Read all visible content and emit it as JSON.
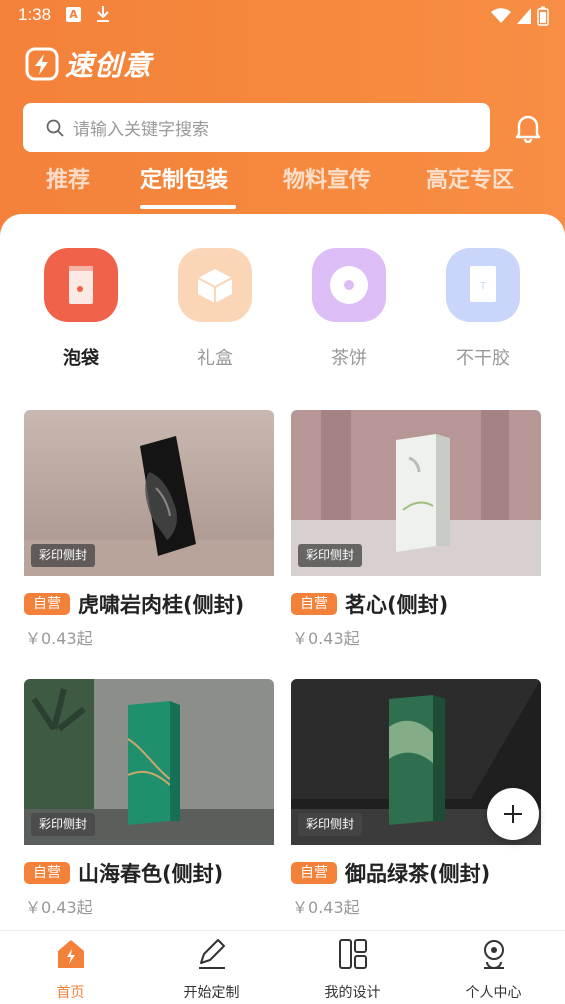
{
  "status_bar": {
    "time": "1:38"
  },
  "header": {
    "logo_text": "速创意",
    "search": {
      "placeholder": "请输入关键字搜索"
    }
  },
  "tabs": [
    {
      "label": "推荐",
      "active": false
    },
    {
      "label": "定制包装",
      "active": true
    },
    {
      "label": "物料宣传",
      "active": false
    },
    {
      "label": "高定专区",
      "active": false
    }
  ],
  "categories": [
    {
      "label": "泡袋",
      "active": true,
      "color": "#f0624a",
      "icon": "bag-icon"
    },
    {
      "label": "礼盒",
      "active": false,
      "color": "#f9c59a",
      "icon": "box-icon"
    },
    {
      "label": "茶饼",
      "active": false,
      "color": "#d1a7f4",
      "icon": "disc-icon"
    },
    {
      "label": "不干胶",
      "active": false,
      "color": "#b7c8f7",
      "icon": "sticker-icon"
    }
  ],
  "products": [
    {
      "badge": "彩印侧封",
      "tag": "自营",
      "title": "虎啸岩肉桂(侧封)",
      "price": "￥0.43起"
    },
    {
      "badge": "彩印侧封",
      "tag": "自营",
      "title": "茗心(侧封)",
      "price": "￥0.43起"
    },
    {
      "badge": "彩印侧封",
      "tag": "自营",
      "title": "山海春色(侧封)",
      "price": "￥0.43起"
    },
    {
      "badge": "彩印侧封",
      "tag": "自营",
      "title": "御品绿茶(侧封)",
      "price": "￥0.43起"
    }
  ],
  "bottom_nav": [
    {
      "label": "首页",
      "active": true,
      "icon": "home-icon"
    },
    {
      "label": "开始定制",
      "active": false,
      "icon": "pencil-icon"
    },
    {
      "label": "我的设计",
      "active": false,
      "icon": "layout-icon"
    },
    {
      "label": "个人中心",
      "active": false,
      "icon": "user-icon"
    }
  ],
  "colors": {
    "accent": "#f4813a",
    "text": "#222222",
    "muted": "#999999"
  }
}
